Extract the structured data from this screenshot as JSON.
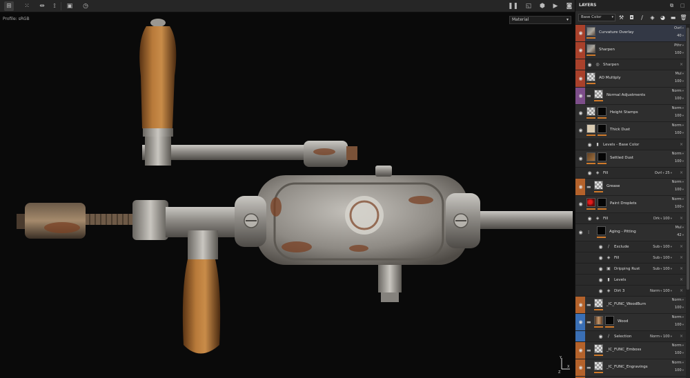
{
  "toolbar": {
    "left_icons": [
      "grid-icon",
      "grid-dotted-icon",
      "mirror-x-icon",
      "symmetry-icon",
      "frame-icon",
      "history-icon"
    ],
    "right_icons": [
      "pause-icon",
      "render-shape-icon",
      "cube-icon",
      "camera-video-icon",
      "screenshot-icon"
    ]
  },
  "viewport": {
    "profile_label": "Profile: sRGB",
    "mode_select": "Material"
  },
  "panel": {
    "title": "LAYERS",
    "channel": "Base Color",
    "tool_icons": [
      "wand-icon",
      "mask-icon",
      "brush-icon",
      "fill-icon",
      "stamp-icon",
      "folder-icon",
      "trash-icon"
    ]
  },
  "colors": {
    "red_tag": "#a9412b",
    "orange_tag": "#b4622b",
    "purple_tag": "#7d4e8a",
    "blue_tag": "#3a6fb5",
    "opacity_bar": "#d07a2a"
  },
  "layers": [
    {
      "kind": "main",
      "name": "Curvature Overlay",
      "blend": "Ovrl",
      "opacity": "40",
      "tag": "red_tag",
      "thumb": "photo",
      "selected": true
    },
    {
      "kind": "main",
      "name": "Sharpen",
      "blend": "Pthr",
      "opacity": "100",
      "tag": "red_tag",
      "thumb": "photo"
    },
    {
      "kind": "sub",
      "name": "Sharpen",
      "icon": "sharpen-icon",
      "tag": "red_tag",
      "indent": 1
    },
    {
      "kind": "main",
      "name": "AO Multiply",
      "blend": "Mul",
      "opacity": "100",
      "tag": "red_tag",
      "thumb": "checker"
    },
    {
      "kind": "main",
      "name": "Normal Adjustments",
      "blend": "Norm",
      "opacity": "100",
      "tag": "purple_tag",
      "thumb": "checker",
      "folder": true
    },
    {
      "kind": "main",
      "name": "Height Stamps",
      "blend": "Norm",
      "opacity": "100",
      "tag": "none",
      "thumb": "checker",
      "mask": true
    },
    {
      "kind": "main",
      "name": "Thick Dust",
      "blend": "Norm",
      "opacity": "100",
      "tag": "none",
      "thumb": "beige",
      "mask": true
    },
    {
      "kind": "sub",
      "name": "Levels - Base Color",
      "icon": "levels-icon",
      "tag": "none",
      "indent": 1
    },
    {
      "kind": "main",
      "name": "Settled Dust",
      "blend": "Norm",
      "opacity": "100",
      "tag": "none",
      "thumb": "brown",
      "mask": true
    },
    {
      "kind": "sub",
      "name": "Fill",
      "icon": "fill-icon",
      "tag": "none",
      "indent": 1,
      "blend": "Ovrl",
      "opacity": "25"
    },
    {
      "kind": "main",
      "name": "Grease",
      "blend": "Norm",
      "opacity": "100",
      "tag": "orange_tag",
      "thumb": "checker",
      "folder": true
    },
    {
      "kind": "main",
      "name": "Paint Droplets",
      "blend": "Norm",
      "opacity": "100",
      "tag": "none",
      "thumb": "red",
      "mask": true
    },
    {
      "kind": "sub",
      "name": "Fill",
      "icon": "fill-icon",
      "tag": "none",
      "indent": 1,
      "blend": "Drk",
      "opacity": "100"
    },
    {
      "kind": "main",
      "name": "Aging - Pitting",
      "blend": "Mul",
      "opacity": "42",
      "tag": "none",
      "thumb": "none",
      "mask": true
    },
    {
      "kind": "sub",
      "name": "Exclude",
      "icon": "brush-icon",
      "tag": "none",
      "indent": 2,
      "blend": "Sub",
      "opacity": "100"
    },
    {
      "kind": "sub",
      "name": "Fill",
      "icon": "fill-icon",
      "tag": "none",
      "indent": 2,
      "blend": "Sub",
      "opacity": "100"
    },
    {
      "kind": "sub",
      "name": "Dripping Rust",
      "icon": "generator-icon",
      "tag": "none",
      "indent": 2,
      "blend": "Sub",
      "opacity": "100"
    },
    {
      "kind": "sub",
      "name": "Levels",
      "icon": "levels-icon",
      "tag": "none",
      "indent": 2
    },
    {
      "kind": "sub",
      "name": "Dirt 3",
      "icon": "fill-icon",
      "tag": "none",
      "indent": 2,
      "blend": "Norm",
      "opacity": "100"
    },
    {
      "kind": "main",
      "name": "_IC_FUNC_WoodBurn",
      "blend": "Norm",
      "opacity": "100",
      "tag": "orange_tag",
      "thumb": "checker",
      "folder": true
    },
    {
      "kind": "main",
      "name": "Wood",
      "blend": "Norm",
      "opacity": "100",
      "tag": "blue_tag",
      "thumb": "wood",
      "folder": true,
      "mask": true
    },
    {
      "kind": "sub",
      "name": "Selection",
      "icon": "brush-icon",
      "tag": "blue_tag",
      "indent": 2,
      "blend": "Norm",
      "opacity": "100"
    },
    {
      "kind": "main",
      "name": "_IC_FUNC_Emboss",
      "blend": "Norm",
      "opacity": "100",
      "tag": "orange_tag",
      "thumb": "checker",
      "folder": true
    },
    {
      "kind": "main",
      "name": "_IC_FUNC_Engravings",
      "blend": "Norm",
      "opacity": "100",
      "tag": "orange_tag",
      "thumb": "checker",
      "folder": true
    },
    {
      "kind": "main",
      "name": "",
      "blend": "",
      "opacity": "",
      "tag": "orange_tag",
      "thumb": "checker",
      "folder": true
    }
  ]
}
